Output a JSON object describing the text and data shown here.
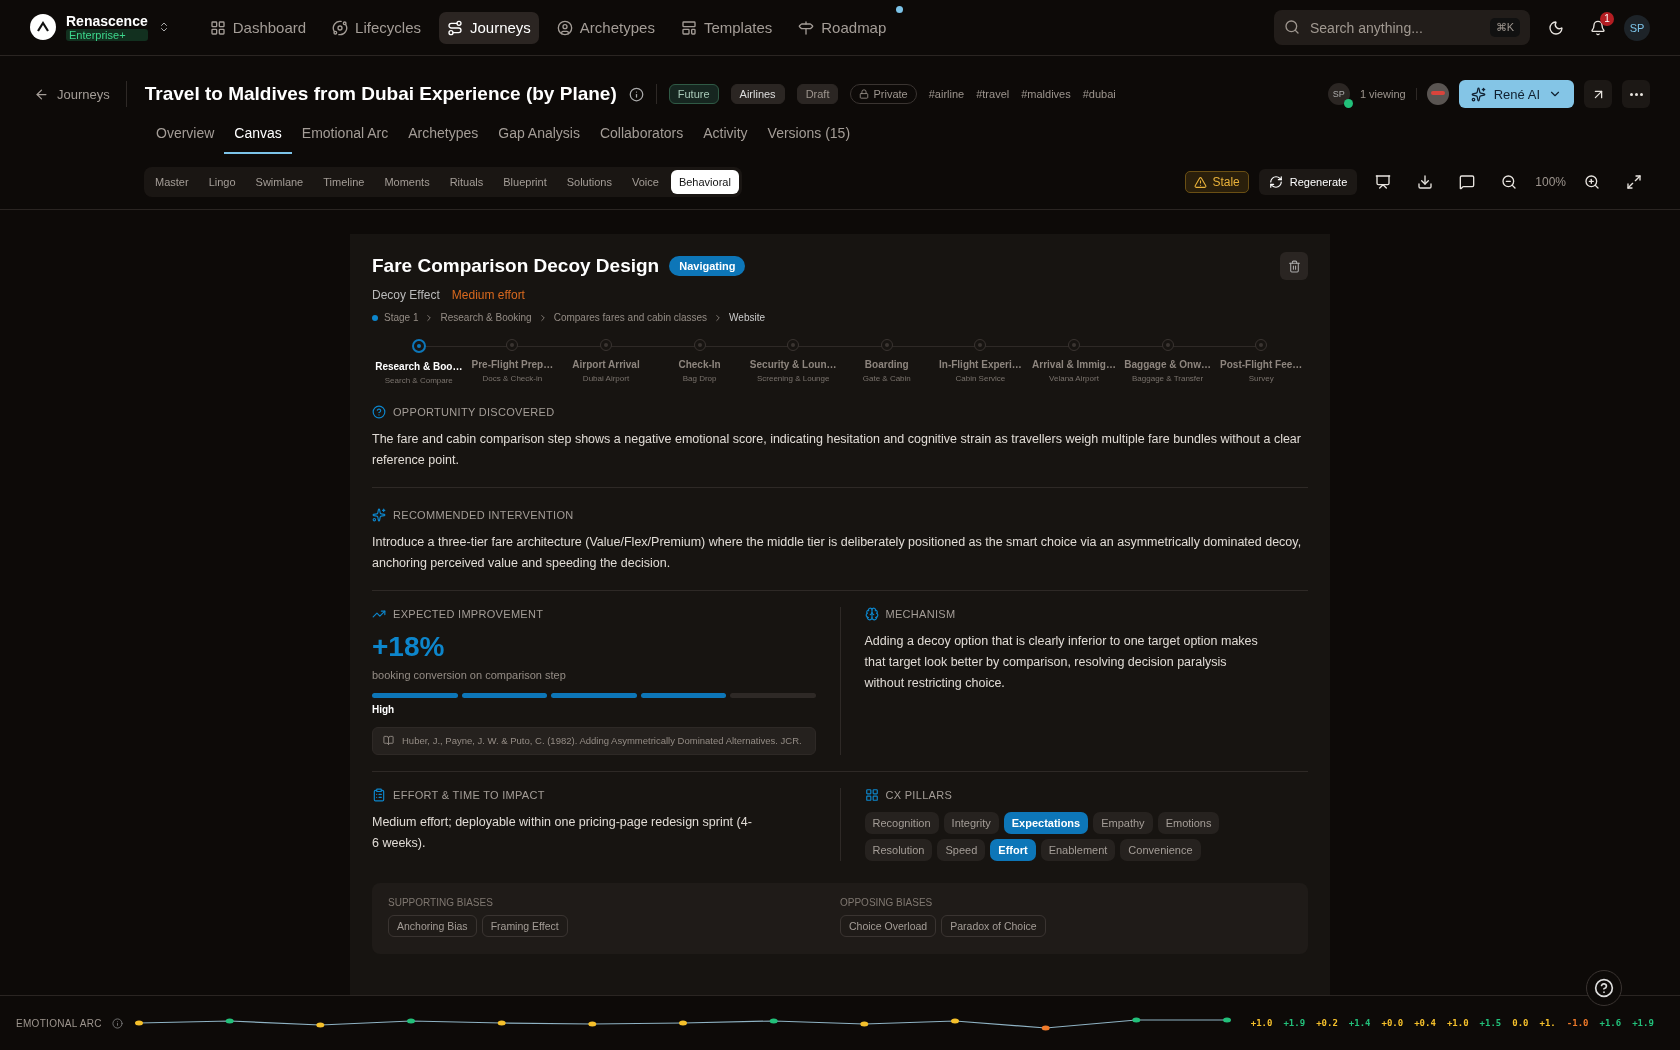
{
  "brand": {
    "name": "Renascence",
    "plan": "Enterprise+"
  },
  "nav": [
    {
      "label": "Dashboard",
      "selected": false,
      "dot": false
    },
    {
      "label": "Lifecycles",
      "selected": false,
      "dot": false
    },
    {
      "label": "Journeys",
      "selected": true,
      "dot": false
    },
    {
      "label": "Archetypes",
      "selected": false,
      "dot": false
    },
    {
      "label": "Templates",
      "selected": false,
      "dot": false
    },
    {
      "label": "Roadmap",
      "selected": false,
      "dot": true
    }
  ],
  "search": {
    "placeholder": "Search anything...",
    "shortcut": "⌘K"
  },
  "notifications": {
    "count": "1"
  },
  "user": {
    "initials": "SP"
  },
  "header": {
    "back": "Journeys",
    "title": "Travel to Maldives from Dubai Experience (by Plane)",
    "badges": [
      {
        "label": "Future",
        "kind": "status"
      },
      {
        "label": "Airlines",
        "kind": "industry"
      },
      {
        "label": "Draft",
        "kind": "plain"
      },
      {
        "label": "Private",
        "kind": "lock"
      }
    ],
    "tags": [
      "#airline",
      "#travel",
      "#maldives",
      "#dubai"
    ],
    "viewer": {
      "initials": "SP",
      "text": "1 viewing"
    },
    "ai_button": "René AI"
  },
  "tabs": [
    {
      "label": "Overview",
      "selected": false
    },
    {
      "label": "Canvas",
      "selected": true
    },
    {
      "label": "Emotional Arc",
      "selected": false
    },
    {
      "label": "Archetypes",
      "selected": false
    },
    {
      "label": "Gap Analysis",
      "selected": false
    },
    {
      "label": "Collaborators",
      "selected": false
    },
    {
      "label": "Activity",
      "selected": false
    },
    {
      "label": "Versions (15)",
      "selected": false
    }
  ],
  "views": [
    {
      "label": "Master",
      "selected": false
    },
    {
      "label": "Lingo",
      "selected": false
    },
    {
      "label": "Swimlane",
      "selected": false
    },
    {
      "label": "Timeline",
      "selected": false
    },
    {
      "label": "Moments",
      "selected": false
    },
    {
      "label": "Rituals",
      "selected": false
    },
    {
      "label": "Blueprint",
      "selected": false
    },
    {
      "label": "Solutions",
      "selected": false
    },
    {
      "label": "Voice",
      "selected": false
    },
    {
      "label": "Behavioral",
      "selected": true
    }
  ],
  "toolbar": {
    "stale": "Stale",
    "regenerate": "Regenerate",
    "zoom": "100%"
  },
  "card": {
    "title": "Fare Comparison Decoy Design",
    "status": "Navigating",
    "bias": "Decoy Effect",
    "effort": "Medium effort",
    "breadcrumb": [
      "Stage 1",
      "Research & Booking",
      "Compares fares and cabin classes",
      "Website"
    ],
    "stages": [
      {
        "name": "Research & Boo…",
        "sub": "Search & Compare",
        "selected": true
      },
      {
        "name": "Pre-Flight Prep…",
        "sub": "Docs & Check-in",
        "selected": false
      },
      {
        "name": "Airport Arrival",
        "sub": "Dubai Airport",
        "selected": false
      },
      {
        "name": "Check-In",
        "sub": "Bag Drop",
        "selected": false
      },
      {
        "name": "Security & Loun…",
        "sub": "Screening & Lounge",
        "selected": false
      },
      {
        "name": "Boarding",
        "sub": "Gate & Cabin",
        "selected": false
      },
      {
        "name": "In-Flight Experi…",
        "sub": "Cabin Service",
        "selected": false
      },
      {
        "name": "Arrival & Immig…",
        "sub": "Velana Airport",
        "selected": false
      },
      {
        "name": "Baggage & Onw…",
        "sub": "Baggage & Transfer",
        "selected": false
      },
      {
        "name": "Post-Flight Fee…",
        "sub": "Survey",
        "selected": false
      }
    ],
    "opportunity": {
      "heading": "OPPORTUNITY DISCOVERED",
      "text": "The fare and cabin comparison step shows a negative emotional score, indicating hesitation and cognitive strain as travellers weigh multiple fare bundles without a clear reference point."
    },
    "intervention": {
      "heading": "RECOMMENDED INTERVENTION",
      "text": "Introduce a three-tier fare architecture (Value/Flex/Premium) where the middle tier is deliberately positioned as the smart choice via an asymmetrically dominated decoy, anchoring perceived value and speeding the decision."
    },
    "improvement": {
      "heading": "EXPECTED IMPROVEMENT",
      "value": "+18%",
      "caption": "booking conversion on comparison step",
      "level": 0.8,
      "confidence": "High",
      "citation": "Huber, J., Payne, J. W. & Puto, C. (1982). Adding Asymmetrically Dominated Alternatives. JCR."
    },
    "mechanism": {
      "heading": "MECHANISM",
      "text": "Adding a decoy option that is clearly inferior to one target option makes that target look better by comparison, resolving decision paralysis without restricting choice."
    },
    "effort_block": {
      "heading": "EFFORT & TIME TO IMPACT",
      "text": "Medium effort; deployable within one pricing-page redesign sprint (4-6 weeks)."
    },
    "pillars": {
      "heading": "CX PILLARS",
      "items": [
        {
          "label": "Recognition",
          "selected": false
        },
        {
          "label": "Integrity",
          "selected": false
        },
        {
          "label": "Expectations",
          "selected": true
        },
        {
          "label": "Empathy",
          "selected": false
        },
        {
          "label": "Emotions",
          "selected": false
        },
        {
          "label": "Resolution",
          "selected": false
        },
        {
          "label": "Speed",
          "selected": false
        },
        {
          "label": "Effort",
          "selected": true
        },
        {
          "label": "Enablement",
          "selected": false
        },
        {
          "label": "Convenience",
          "selected": false
        }
      ]
    },
    "supporting": {
      "heading": "SUPPORTING BIASES",
      "items": [
        "Anchoring Bias",
        "Framing Effect"
      ]
    },
    "opposing": {
      "heading": "OPPOSING BIASES",
      "items": [
        "Choice Overload",
        "Paradox of Choice"
      ]
    }
  },
  "emotional_arc": {
    "label": "EMOTIONAL ARC",
    "scores": [
      {
        "text": "+1.0",
        "color": "#f5c02b"
      },
      {
        "text": "+1.9",
        "color": "#22c07a"
      },
      {
        "text": "+0.2",
        "color": "#f5c02b"
      },
      {
        "text": "+1.4",
        "color": "#22c07a"
      },
      {
        "text": "+0.0",
        "color": "#f5c02b"
      },
      {
        "text": "+0.4",
        "color": "#f5c02b"
      },
      {
        "text": "+1.0",
        "color": "#f5c02b"
      },
      {
        "text": "+1.5",
        "color": "#22c07a"
      },
      {
        "text": "0.0",
        "color": "#f5c02b"
      },
      {
        "text": "+1.",
        "color": "#f5c02b"
      },
      {
        "text": "-1.0",
        "color": "#f07a2a"
      },
      {
        "text": "+1.6",
        "color": "#22c07a"
      },
      {
        "text": "+1.9",
        "color": "#22c07a"
      }
    ]
  }
}
